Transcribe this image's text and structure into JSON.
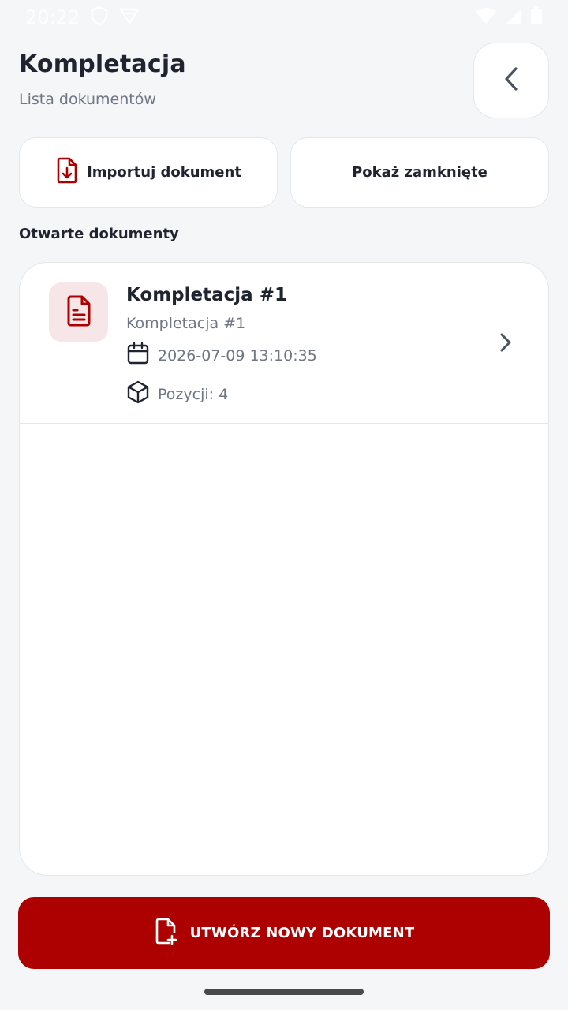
{
  "status_bar": {
    "time": "20:22"
  },
  "header": {
    "title": "Kompletacja",
    "subtitle": "Lista dokumentów"
  },
  "actions": {
    "import_label": "Importuj dokument",
    "show_closed_label": "Pokaż zamknięte"
  },
  "section": {
    "open_documents_label": "Otwarte dokumenty"
  },
  "documents": [
    {
      "title": "Kompletacja #1",
      "subtitle": "Kompletacja #1",
      "date": "2026-07-09 13:10:35",
      "positions": "Pozycji: 4"
    }
  ],
  "footer": {
    "create_label": "UTWÓRZ NOWY DOKUMENT"
  },
  "colors": {
    "accent": "#ad0000",
    "accent_soft": "#f7e6e7",
    "background": "#f5f6f8",
    "muted_text": "#6f7684"
  },
  "icons": {
    "back": "chevron-left-icon",
    "import": "file-download-icon",
    "document": "file-text-icon",
    "date": "calendar-icon",
    "positions": "box-icon",
    "open": "chevron-right-icon",
    "create": "file-plus-icon"
  }
}
